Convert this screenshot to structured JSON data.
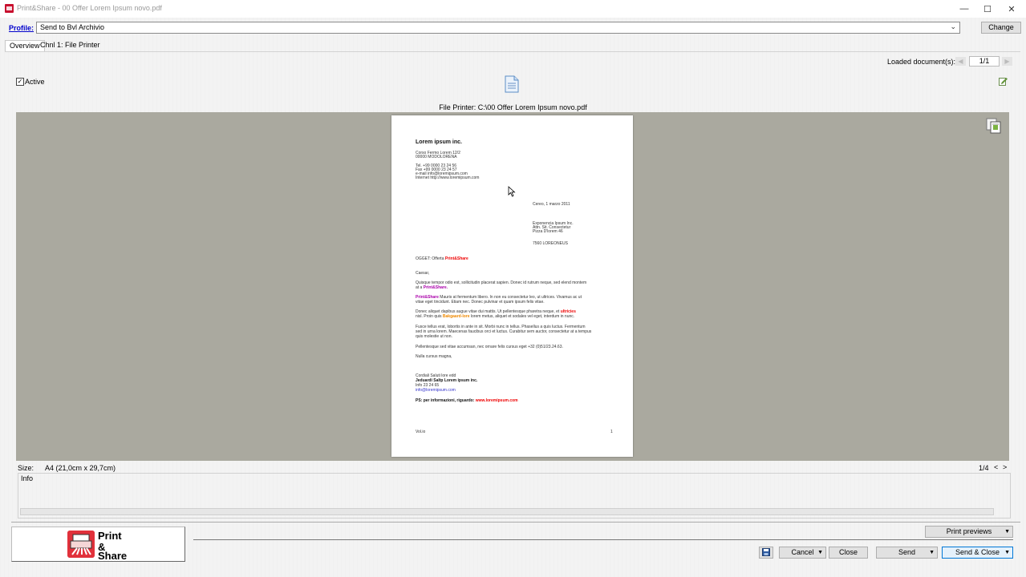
{
  "window": {
    "title": "Print&Share - 00 Offer Lorem Ipsum novo.pdf",
    "minimize": "—",
    "maximize": "☐",
    "close": "✕"
  },
  "profile": {
    "label": "Profile:",
    "value": "Send to Bvl Archivio",
    "change_label": "Change"
  },
  "tabs": [
    {
      "label": "Overview",
      "active": true
    },
    {
      "label": "Chnl 1: File Printer",
      "active": false
    }
  ],
  "loaded_documents": {
    "label": "Loaded document(s):",
    "count": "1/1"
  },
  "channel": {
    "active_label": "Active",
    "active_checked": "✓",
    "file_printer_caption": "File Printer: C:\\00 Offer Lorem Ipsum novo.pdf"
  },
  "letter": {
    "company": "Lorem ipsum inc.",
    "address_lines": [
      "Corso Fermo Lorem 12/2",
      "00000 MODOLORENA"
    ],
    "contact_lines": [
      "Tel. +99 0000 23 24 56",
      "Fax +99 0000 23 24 57",
      "e-mail info@loremipsum.com",
      "Internet http://www.loremipsum.com"
    ],
    "date": "Cereo, 1 marzo 2011",
    "recipient_lines": [
      "Exponencia Ipsum Inc.",
      "Attn. Sit. Consectetur",
      "Pizza D'lorem 46"
    ],
    "recipient_city": "7560 LOREONEUS",
    "subject_prefix": "OGGET: Offerta ",
    "subject_brand": "Print&Share",
    "greeting": "Caesar,",
    "p1_a": "Quisque tempor odio est, sollicitudin placerat sapien. Donec id rutrum neque, sed elend montem",
    "p1_b": "at a ",
    "p1_brand": "Print&Share.",
    "p2_brand": "Print&Share",
    "p2_a": " Mauris at fermentum libero. In non eu consectetur leo, ut ultrices. Vivamus ac ut",
    "p2_b": "vitae eget tincidunt. Etiam nec. Donec pulvinar et quam ipsum felis vitae.",
    "p3_a": "Donec aliquet dapibus augue vitae dui mattis. Ut pellentesque pharetra neque, et ",
    "p3_brand1": "ultricies",
    "p3_b": "nisl. Proin quis ",
    "p3_brand2": "Bakgaard-lore",
    "p3_c": " lorem metus, aliquet et sodales vel eget, interdum in nunc.",
    "p4_a": "Fusce tellus erat, lobortis in ante in sit. Morbi nunc in tellus. Phasellus a quis luctus. Fermentum",
    "p4_b": "sed in urna lorem. Maecenas faucibus orci et luctus. Curabitur sem auctor, consectetur at a tempus",
    "p4_c": "quis molestie ut non.",
    "p5": "Pellentesque sed vitae accumsan, nec ornare felis cursus eget +32 (0)51/23.24.63.",
    "closing": "Nulla cursus magna,",
    "sign_1": "Cordiali Saluti lore edd",
    "sign_2": "Jeduardi Saltp Lorem ipsum inc.",
    "sign_3": "Info 23 24 65",
    "sign_4": "info@loremipsum.com",
    "ps_prefix": "PS: per informazioni, riguardo: ",
    "ps_link": "www.loremipsum.com",
    "footer_left": "Vol.io",
    "footer_right": "1"
  },
  "preview_info": {
    "size_label": "Size:",
    "size_value": "A4 (21,0cm x 29,7cm)",
    "page_indicator": "1/4",
    "prev": "<",
    "next": ">",
    "info_label": "Info"
  },
  "logo": {
    "line1": "Print",
    "line2": "&",
    "line3": "Share"
  },
  "actions": {
    "print_previews": "Print previews",
    "cancel": "Cancel",
    "close": "Close",
    "send": "Send",
    "send_close": "Send & Close",
    "dropdown_arrow": "▼"
  },
  "colors": {
    "brand_red": "#e1313b",
    "preview_background": "#aaa99f",
    "primary_button_border": "#0078d7",
    "link_blue": "#0000cc"
  },
  "icons": {
    "app": "print-share-app-icon",
    "document": "document-icon",
    "edit": "edit-icon",
    "copy": "copy-pages-icon",
    "save": "save-icon",
    "cursor": "mouse-cursor-icon"
  }
}
